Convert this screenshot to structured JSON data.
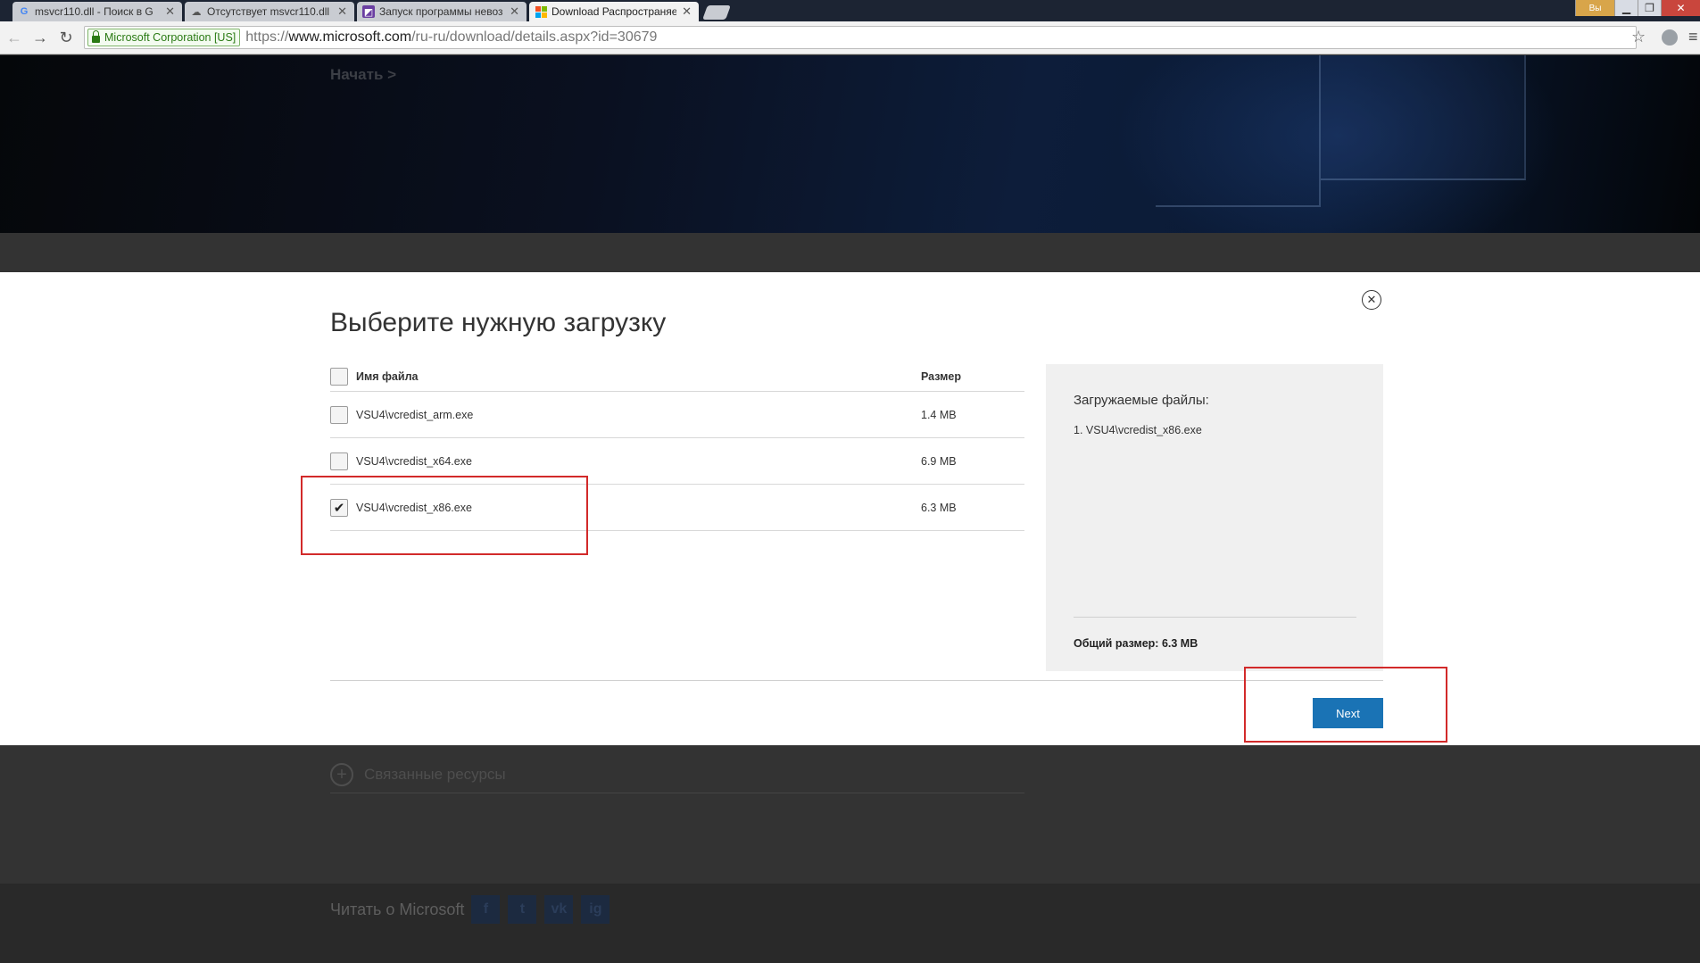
{
  "browser": {
    "tabs": [
      {
        "title": "msvcr110.dll - Поиск в G",
        "favicon": "G",
        "color": "#4285f4"
      },
      {
        "title": "Отсутствует msvcr110.dll",
        "favicon": "☁",
        "color": "#555555"
      },
      {
        "title": "Запуск программы невоз",
        "favicon": "◩",
        "color": "#6a3ea1"
      },
      {
        "title": "Download Распространяе",
        "favicon": "ms",
        "color": "#f25022",
        "active": true
      }
    ],
    "close_glyph": "✕",
    "user_label": "Вы",
    "ev_label": "Microsoft Corporation [US]",
    "url_scheme": "https://",
    "url_host": "www.microsoft.com",
    "url_path": "/ru-ru/download/details.aspx?id=30679"
  },
  "hero": {
    "breadcrumb": "Начать >"
  },
  "modal": {
    "title": "Выберите нужную загрузку",
    "header_name": "Имя файла",
    "header_size": "Размер",
    "files": [
      {
        "name": "VSU4\\vcredist_arm.exe",
        "size": "1.4 MB",
        "checked": false
      },
      {
        "name": "VSU4\\vcredist_x64.exe",
        "size": "6.9 MB",
        "checked": false
      },
      {
        "name": "VSU4\\vcredist_x86.exe",
        "size": "6.3 MB",
        "checked": true
      }
    ],
    "summary_title": "Загружаемые файлы:",
    "summary_item": "1. VSU4\\vcredist_x86.exe",
    "summary_total": "Общий размер: 6.3 MB",
    "next_label": "Next"
  },
  "page": {
    "related": "Связанные ресурсы",
    "read_about": "Читать о Microsoft",
    "social": [
      "f",
      "t",
      "vk",
      "ig"
    ]
  },
  "colors": {
    "accent": "#1a73b5",
    "annotation": "#d22a2a"
  }
}
